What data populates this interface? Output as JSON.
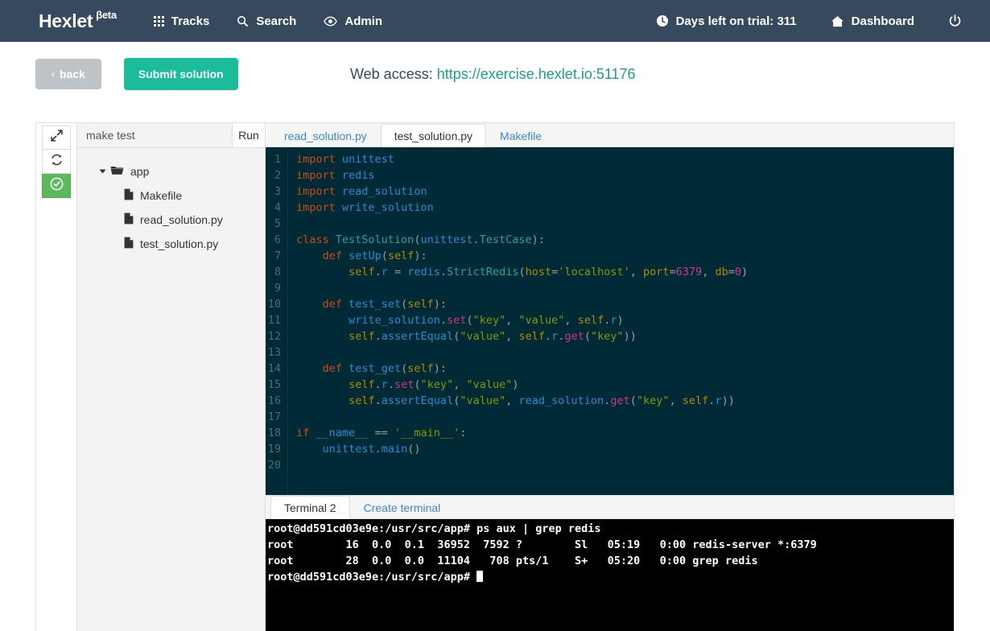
{
  "navbar": {
    "brand": "Hexlet",
    "brand_sup": "βeta",
    "left_items": [
      {
        "icon": "grid-icon",
        "label": "Tracks"
      },
      {
        "icon": "search-icon",
        "label": "Search"
      },
      {
        "icon": "eye-icon",
        "label": "Admin"
      }
    ],
    "right_items": [
      {
        "icon": "clock-icon",
        "label": "Days left on trial: 311"
      },
      {
        "icon": "home-icon",
        "label": "Dashboard"
      }
    ],
    "power_icon": "power-icon",
    "background": "#37495c"
  },
  "actions": {
    "back_label": "back",
    "back_chevron": "‹",
    "submit_label": "Submit solution",
    "submit_color": "#1abc9c",
    "web_access_label": "Web access:",
    "web_access_url": "https://exercise.hexlet.io:51176",
    "web_access_color": "#1aa085"
  },
  "icon_strip": [
    {
      "name": "expand-icon",
      "active": false
    },
    {
      "name": "refresh-icon",
      "active": false
    },
    {
      "name": "check-circle-icon",
      "active": true
    }
  ],
  "file_panel": {
    "command_value": "make test",
    "command_placeholder": "make test",
    "run_label": "Run",
    "tree": [
      {
        "type": "folder",
        "icon": "folder-open-icon",
        "label": "app",
        "expanded": true
      },
      {
        "type": "file",
        "icon": "file-icon",
        "label": "Makefile"
      },
      {
        "type": "file",
        "icon": "file-icon",
        "label": "read_solution.py"
      },
      {
        "type": "file",
        "icon": "file-icon",
        "label": "test_solution.py"
      }
    ]
  },
  "editor": {
    "tabs": [
      {
        "label": "read_solution.py",
        "active": false
      },
      {
        "label": "test_solution.py",
        "active": true
      },
      {
        "label": "Makefile",
        "active": false
      }
    ],
    "background": "#002b36",
    "line_numbers": [
      "1",
      "2",
      "3",
      "4",
      "5",
      "6",
      "7",
      "8",
      "9",
      "10",
      "11",
      "12",
      "13",
      "14",
      "15",
      "16",
      "17",
      "18",
      "19",
      "20"
    ],
    "code_lines": [
      "import unittest",
      "import redis",
      "import read_solution",
      "import write_solution",
      "",
      "class TestSolution(unittest.TestCase):",
      "    def setUp(self):",
      "        self.r = redis.StrictRedis(host='localhost', port=6379, db=0)",
      "",
      "    def test_set(self):",
      "        write_solution.set(\"key\", \"value\", self.r)",
      "        self.assertEqual(\"value\", self.r.get(\"key\"))",
      "",
      "    def test_get(self):",
      "        self.r.set(\"key\", \"value\")",
      "        self.assertEqual(\"value\", read_solution.get(\"key\", self.r))",
      "",
      "if __name__ == '__main__':",
      "    unittest.main()",
      ""
    ]
  },
  "terminal": {
    "tabs": [
      {
        "label": "Terminal 2",
        "active": true
      },
      {
        "label": "Create terminal",
        "active": false
      }
    ],
    "prompt": "root@dd591cd03e9e:/usr/src/app#",
    "lines": [
      "root@dd591cd03e9e:/usr/src/app# ps aux | grep redis",
      "root        16  0.0  0.1  36952  7592 ?        Sl   05:19   0:00 redis-server *:6379",
      "root        28  0.0  0.0  11104   708 pts/1    S+   05:20   0:00 grep redis"
    ],
    "last_prompt": "root@dd591cd03e9e:/usr/src/app# ",
    "background": "#000000"
  }
}
